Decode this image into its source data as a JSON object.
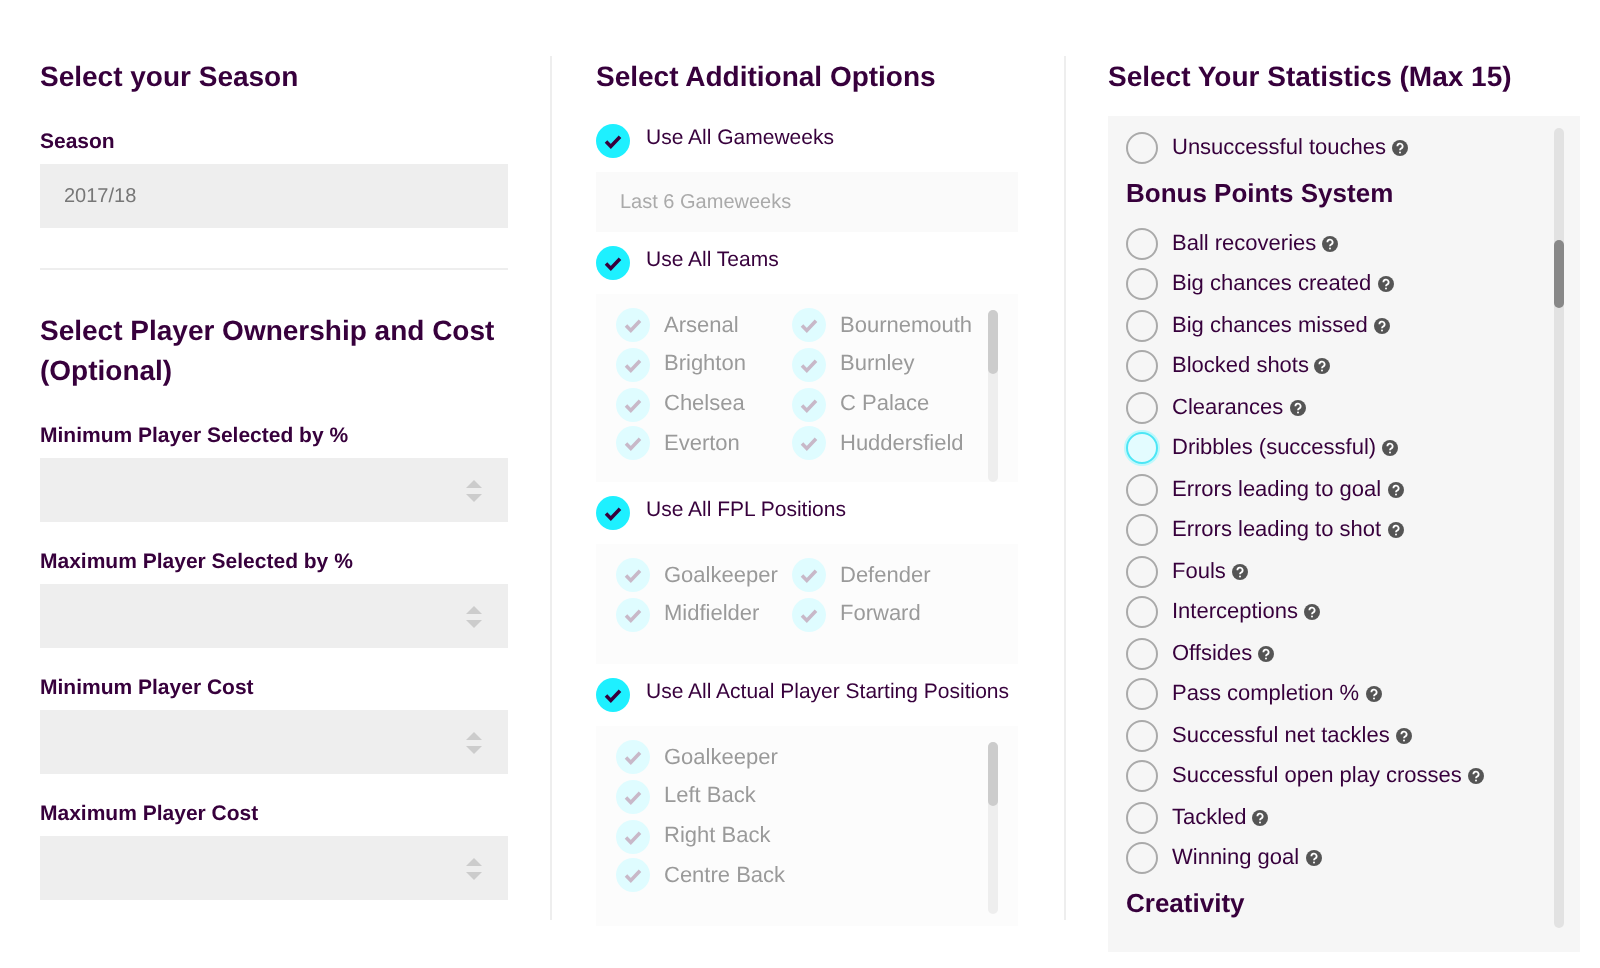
{
  "season": {
    "title": "Select your Season",
    "label": "Season",
    "value": "2017/18"
  },
  "ownership": {
    "title": "Select Player Ownership and Cost (Optional)",
    "fields": [
      {
        "label": "Minimum Player Selected by %"
      },
      {
        "label": "Maximum Player Selected by %"
      },
      {
        "label": "Minimum Player Cost"
      },
      {
        "label": "Maximum Player Cost"
      }
    ]
  },
  "options": {
    "title": "Select Additional Options",
    "groups": [
      {
        "kind": "field",
        "label": "Use All Gameweeks",
        "checked": true,
        "placeholder": "Last 6 Gameweeks"
      },
      {
        "kind": "scrolling-grid",
        "label": "Use All Teams",
        "checked": true,
        "items": [
          {
            "label": "Arsenal",
            "checked": true
          },
          {
            "label": "Bournemouth",
            "checked": true
          },
          {
            "label": "Brighton",
            "checked": true
          },
          {
            "label": "Burnley",
            "checked": true
          },
          {
            "label": "Chelsea",
            "checked": true
          },
          {
            "label": "C Palace",
            "checked": true
          },
          {
            "label": "Everton",
            "checked": true
          },
          {
            "label": "Huddersfield",
            "checked": true
          }
        ]
      },
      {
        "kind": "grid",
        "label": "Use All FPL Positions",
        "checked": true,
        "items": [
          {
            "label": "Goalkeeper",
            "checked": true
          },
          {
            "label": "Defender",
            "checked": true
          },
          {
            "label": "Midfielder",
            "checked": true
          },
          {
            "label": "Forward",
            "checked": true
          }
        ]
      },
      {
        "kind": "scrolling-list",
        "label": "Use All Actual Player Starting Positions",
        "checked": true,
        "items": [
          {
            "label": "Goalkeeper",
            "checked": true
          },
          {
            "label": "Left Back",
            "checked": true
          },
          {
            "label": "Right Back",
            "checked": true
          },
          {
            "label": "Centre Back",
            "checked": true
          }
        ]
      }
    ]
  },
  "statistics": {
    "title": "Select Your Statistics (Max 15)",
    "entries": [
      {
        "kind": "option",
        "label": "Unsuccessful touches",
        "checked": false,
        "focused": false
      },
      {
        "kind": "heading",
        "label": "Bonus Points System"
      },
      {
        "kind": "option",
        "label": "Ball recoveries",
        "checked": false,
        "focused": false
      },
      {
        "kind": "option",
        "label": "Big chances created",
        "checked": false,
        "focused": false
      },
      {
        "kind": "option",
        "label": "Big chances missed",
        "checked": false,
        "focused": false
      },
      {
        "kind": "option",
        "label": "Blocked shots",
        "checked": false,
        "focused": false
      },
      {
        "kind": "option",
        "label": "Clearances",
        "checked": false,
        "focused": false
      },
      {
        "kind": "option",
        "label": "Dribbles (successful)",
        "checked": false,
        "focused": true
      },
      {
        "kind": "option",
        "label": "Errors leading to goal",
        "checked": false,
        "focused": false
      },
      {
        "kind": "option",
        "label": "Errors leading to shot",
        "checked": false,
        "focused": false
      },
      {
        "kind": "option",
        "label": "Fouls",
        "checked": false,
        "focused": false
      },
      {
        "kind": "option",
        "label": "Interceptions",
        "checked": false,
        "focused": false
      },
      {
        "kind": "option",
        "label": "Offsides",
        "checked": false,
        "focused": false
      },
      {
        "kind": "option",
        "label": "Pass completion %",
        "checked": false,
        "focused": false
      },
      {
        "kind": "option",
        "label": "Successful net tackles",
        "checked": false,
        "focused": false
      },
      {
        "kind": "option",
        "label": "Successful open play crosses",
        "checked": false,
        "focused": false
      },
      {
        "kind": "option",
        "label": "Tackled",
        "checked": false,
        "focused": false
      },
      {
        "kind": "option",
        "label": "Winning goal",
        "checked": false,
        "focused": false
      },
      {
        "kind": "heading",
        "label": "Creativity"
      }
    ]
  }
}
